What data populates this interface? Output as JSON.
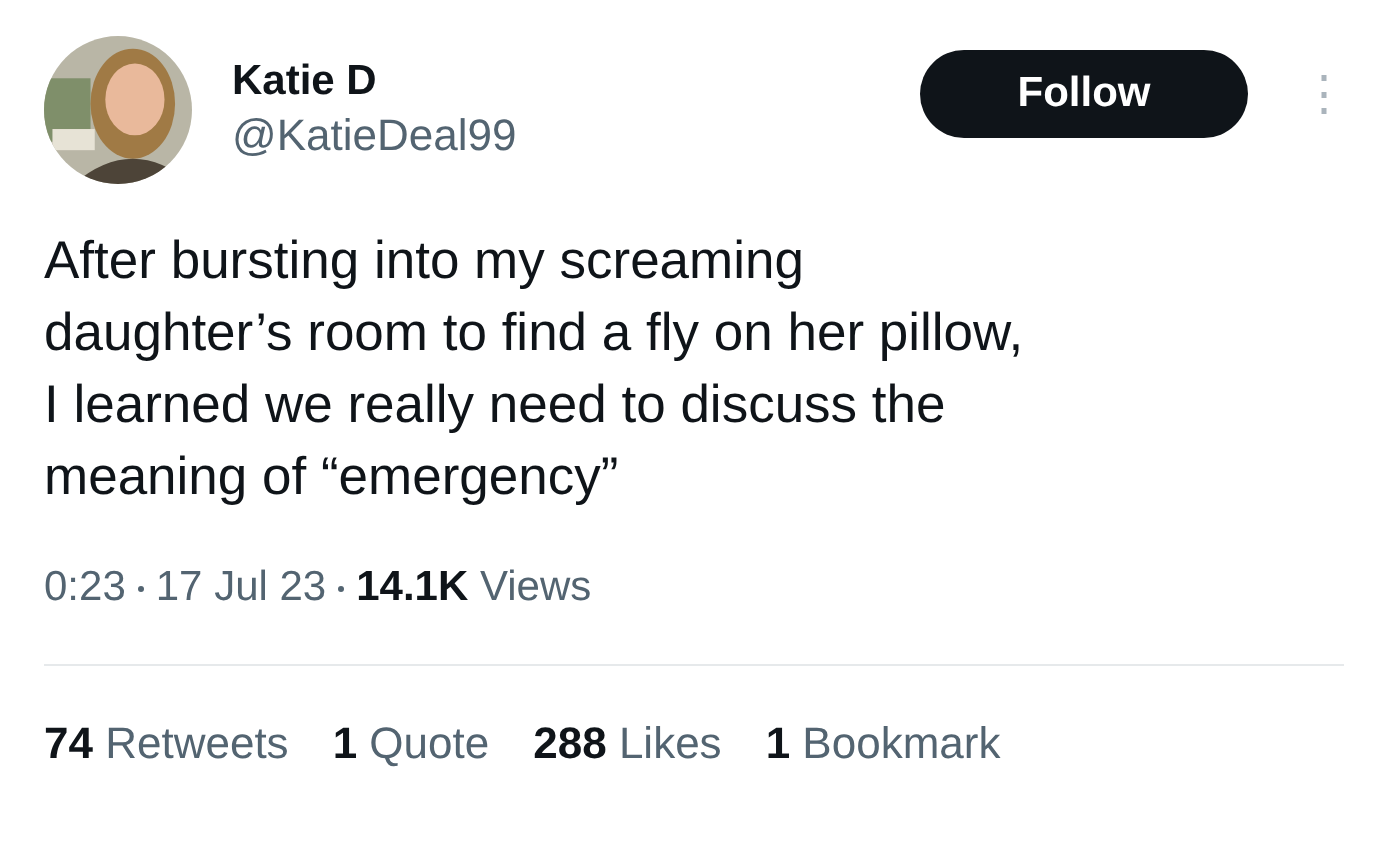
{
  "author": {
    "name": "Katie D",
    "handle": "@KatieDeal99"
  },
  "follow_button": "Follow",
  "more_button": "⋮",
  "text": "After bursting into my screaming daughter’s room to find a fly on her pillow, I learned we really need to discuss the meaning of “emergency”",
  "meta": {
    "time": "0:23",
    "date": "17 Jul 23",
    "views_count": "14.1K",
    "views_label": "Views"
  },
  "stats": [
    {
      "count": "74",
      "label": "Retweets"
    },
    {
      "count": "1",
      "label": "Quote"
    },
    {
      "count": "288",
      "label": "Likes"
    },
    {
      "count": "1",
      "label": "Bookmark"
    }
  ]
}
